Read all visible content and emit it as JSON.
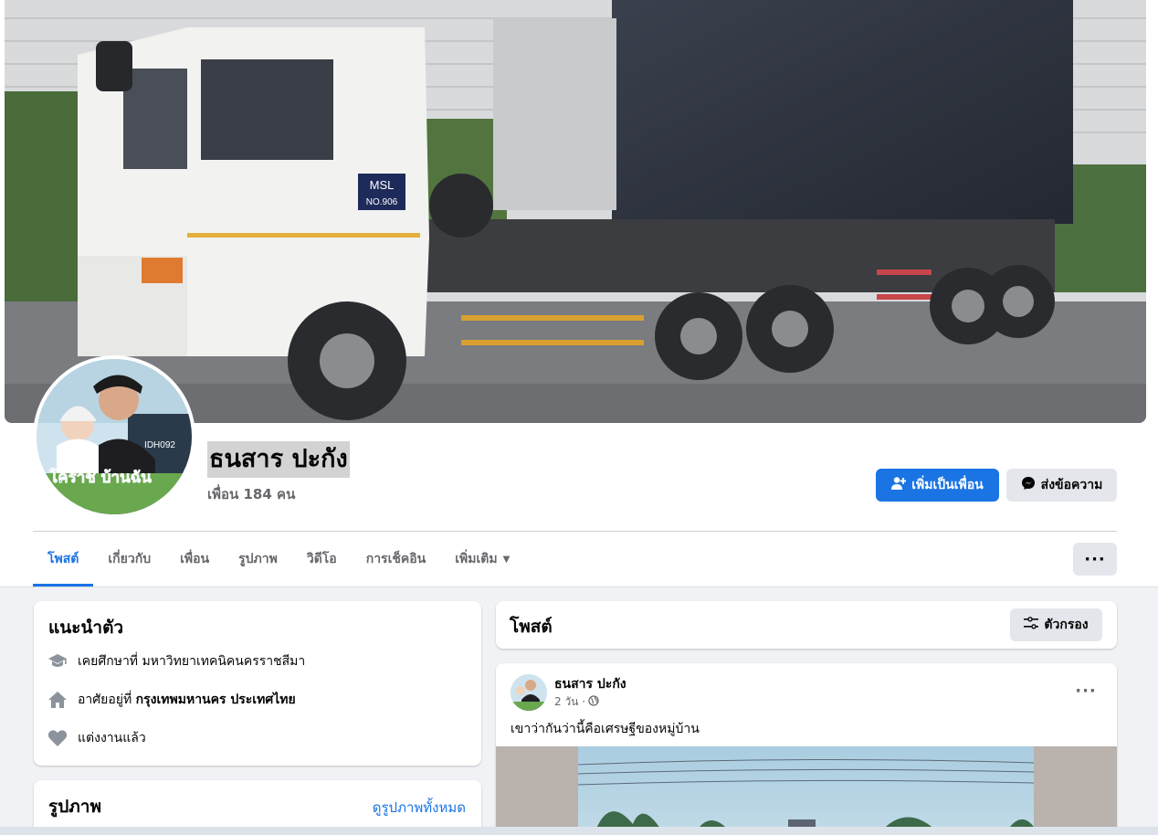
{
  "profile": {
    "name": "ธนสาร ปะกัง",
    "friends": "เพื่อน 184 คน"
  },
  "actions": {
    "add_friend": "เพิ่มเป็นเพื่อน",
    "message": "ส่งข้อความ"
  },
  "tabs": [
    {
      "label": "โพสต์",
      "active": true
    },
    {
      "label": "เกี่ยวกับ"
    },
    {
      "label": "เพื่อน"
    },
    {
      "label": "รูปภาพ"
    },
    {
      "label": "วิดีโอ"
    },
    {
      "label": "การเช็คอิน"
    },
    {
      "label": "เพิ่มเติม"
    }
  ],
  "intro": {
    "title": "แนะนำตัว",
    "education": "เคยศึกษาที่ มหาวิทยาเทคนิคนครราชสีมา",
    "lives_prefix": "อาศัยอยู่ที่ ",
    "lives_place": "กรุงเทพมหานคร ประเทศไทย",
    "relationship": "แต่งงานแล้ว"
  },
  "photos": {
    "title": "รูปภาพ",
    "see_all": "ดูรูปภาพทั้งหมด"
  },
  "posts": {
    "title": "โพสต์",
    "filter": "ตัวกรอง"
  },
  "post": {
    "author": "ธนสาร ปะกัง",
    "time": "2 วัน ·",
    "text": "เขาว่ากันว่านี้คือเศรษฐีของหมู่บ้าน"
  },
  "cover_text": {
    "truck_id": "MSL",
    "truck_no": "NO.906",
    "avatar_plate": "IDH092",
    "avatar_caption": "โคราช บ้านฉัน"
  },
  "colors": {
    "accent": "#1b74e4",
    "background": "#f0f2f5"
  }
}
